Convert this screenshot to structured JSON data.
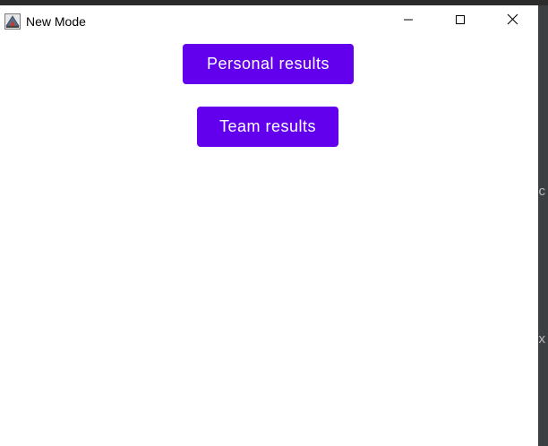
{
  "window": {
    "title": "New Mode",
    "icon": "java-app-icon",
    "controls": [
      "minimize-icon",
      "maximize-icon",
      "close-icon"
    ]
  },
  "main": {
    "buttons": {
      "personal_label": "Personal results",
      "team_label": "Team results"
    }
  },
  "background": {
    "glyph_c": "c",
    "glyph_x": "x"
  },
  "colors": {
    "accent": "#6200ee",
    "button_text": "#ffffff",
    "window_bg": "#ffffff",
    "desktop_bg": "#3c3f41"
  }
}
